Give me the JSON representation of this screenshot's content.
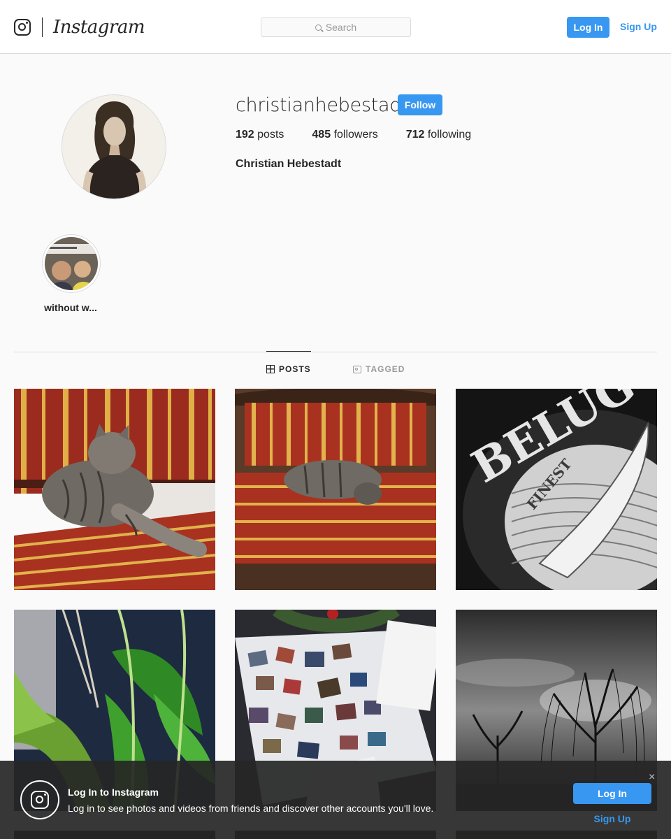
{
  "header": {
    "logo_icon": "instagram-glyph-icon",
    "wordmark": "Instagram",
    "search_placeholder": "Search",
    "login_label": "Log In",
    "signup_label": "Sign Up"
  },
  "profile": {
    "username": "christianhebestadt",
    "follow_label": "Follow",
    "stats": [
      {
        "count": "192",
        "label": "posts"
      },
      {
        "count": "485",
        "label": "followers"
      },
      {
        "count": "712",
        "label": "following"
      }
    ],
    "full_name": "Christian Hebestadt"
  },
  "highlights": [
    {
      "label": "without w..."
    }
  ],
  "tabs": [
    {
      "label": "POSTS",
      "icon": "grid-icon",
      "active": true
    },
    {
      "label": "TAGGED",
      "icon": "tagged-icon",
      "active": false
    }
  ],
  "posts": [
    {
      "subject": "cat-on-striped-sofa"
    },
    {
      "subject": "cat-on-striped-chair"
    },
    {
      "subject": "beluga-bottle-fish-emblem"
    },
    {
      "subject": "green-plant-leaves"
    },
    {
      "subject": "photo-collage-on-table"
    },
    {
      "subject": "bare-tree-grayscale-sky"
    },
    {
      "subject": "dark-photo"
    },
    {
      "subject": "dark-photo"
    },
    {
      "subject": "dark-photo"
    }
  ],
  "banner": {
    "title": "Log In to Instagram",
    "text": "Log in to see photos and videos from friends and discover other accounts you'll love.",
    "login_label": "Log In",
    "signup_label": "Sign Up",
    "close_glyph": "×"
  },
  "colors": {
    "accent": "#3897f0",
    "text": "#262626",
    "border": "#dbdbdb",
    "background": "#fafafa"
  }
}
